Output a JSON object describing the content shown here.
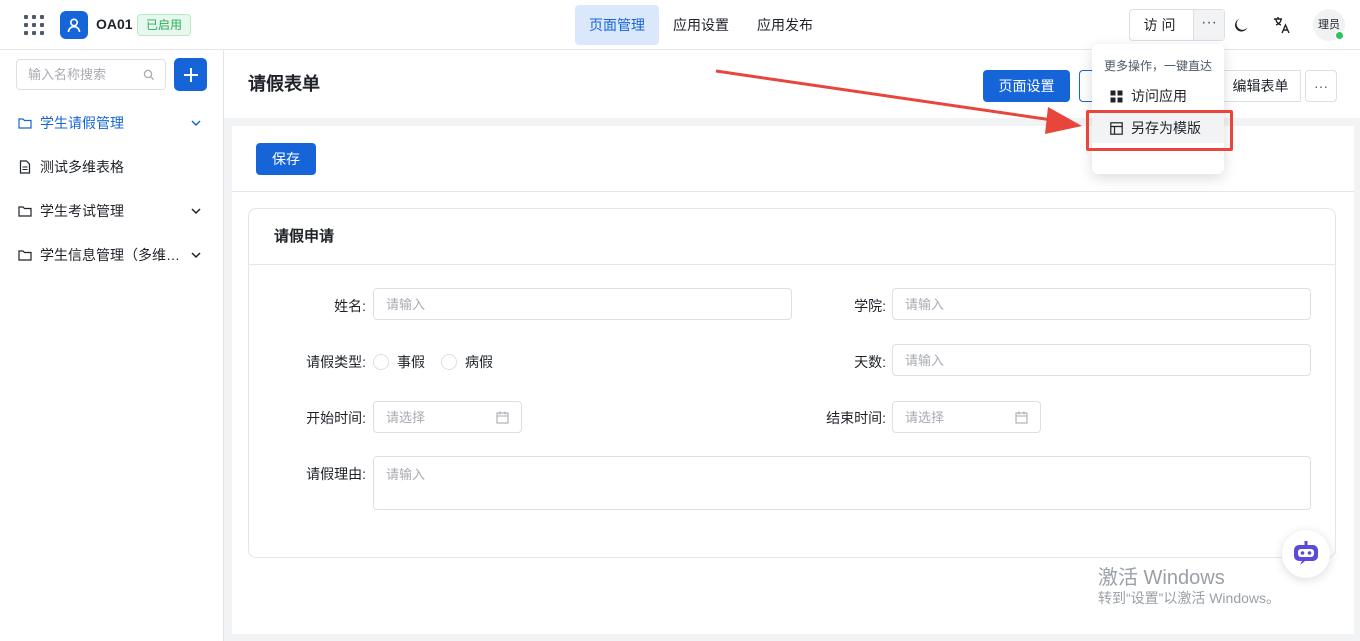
{
  "app": {
    "name": "OA01",
    "status": "已启用"
  },
  "nav": [
    {
      "label": "页面管理",
      "active": true
    },
    {
      "label": "应用设置",
      "active": false
    },
    {
      "label": "应用发布",
      "active": false
    }
  ],
  "header": {
    "visit_label": "访问",
    "more_label": "···",
    "avatar_text": "理员"
  },
  "sidebar": {
    "search_placeholder": "输入名称搜索",
    "items": [
      {
        "label": "学生请假管理",
        "icon": "folder-icon",
        "active": true,
        "expandable": true
      },
      {
        "label": "测试多维表格",
        "icon": "document-icon",
        "active": false,
        "expandable": false
      },
      {
        "label": "学生考试管理",
        "icon": "folder-icon",
        "active": false,
        "expandable": true
      },
      {
        "label": "学生信息管理（多维表格）",
        "icon": "folder-icon",
        "active": false,
        "expandable": true
      }
    ]
  },
  "page": {
    "title": "请假表单",
    "settings_label": "页面设置",
    "edit_form_label": "编辑表单",
    "more_label": "···"
  },
  "toolbar": {
    "save_label": "保存"
  },
  "form": {
    "section_title": "请假申请",
    "fields": {
      "name": {
        "label": "姓名:",
        "placeholder": "请输入"
      },
      "college": {
        "label": "学院:",
        "placeholder": "请输入"
      },
      "leave_type": {
        "label": "请假类型:",
        "options": [
          "事假",
          "病假"
        ]
      },
      "days": {
        "label": "天数:",
        "placeholder": "请输入"
      },
      "start_time": {
        "label": "开始时间:",
        "placeholder": "请选择"
      },
      "end_time": {
        "label": "结束时间:",
        "placeholder": "请选择"
      },
      "reason": {
        "label": "请假理由:",
        "placeholder": "请输入"
      }
    }
  },
  "dropdown": {
    "title": "更多操作，一键直达",
    "items": [
      {
        "label": "访问应用",
        "icon": "apps-icon"
      },
      {
        "label": "另存为模版",
        "icon": "template-icon"
      }
    ]
  },
  "watermark": {
    "line1": "激活 Windows",
    "line2": "转到“设置”以激活 Windows。"
  },
  "colors": {
    "primary": "#1665d8",
    "success": "#23b15a",
    "annotation": "#e8453c"
  }
}
